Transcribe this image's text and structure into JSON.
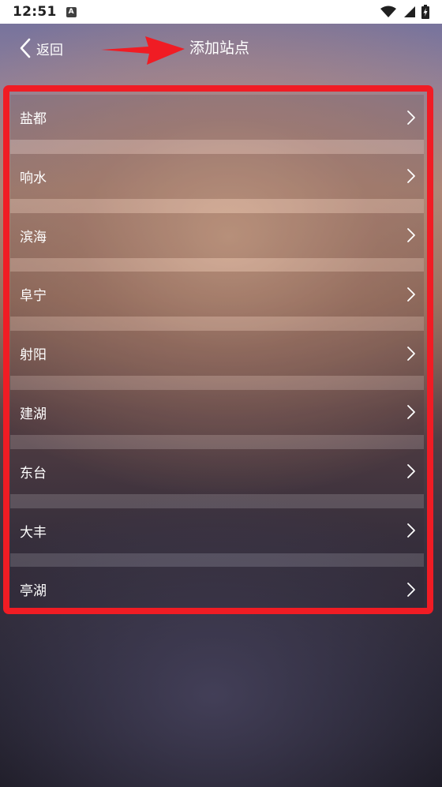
{
  "status_bar": {
    "time": "12:51",
    "notification_icon": "A",
    "icons": [
      "wifi-icon",
      "signal-icon",
      "battery-charging-icon"
    ]
  },
  "header": {
    "back_label": "返回",
    "title": "添加站点"
  },
  "annotation": {
    "arrow_color": "#f01c24",
    "box_color": "#f01c24"
  },
  "stations": [
    {
      "label": "盐都"
    },
    {
      "label": "响水"
    },
    {
      "label": "滨海"
    },
    {
      "label": "阜宁"
    },
    {
      "label": "射阳"
    },
    {
      "label": "建湖"
    },
    {
      "label": "东台"
    },
    {
      "label": "大丰"
    },
    {
      "label": "亭湖"
    }
  ]
}
